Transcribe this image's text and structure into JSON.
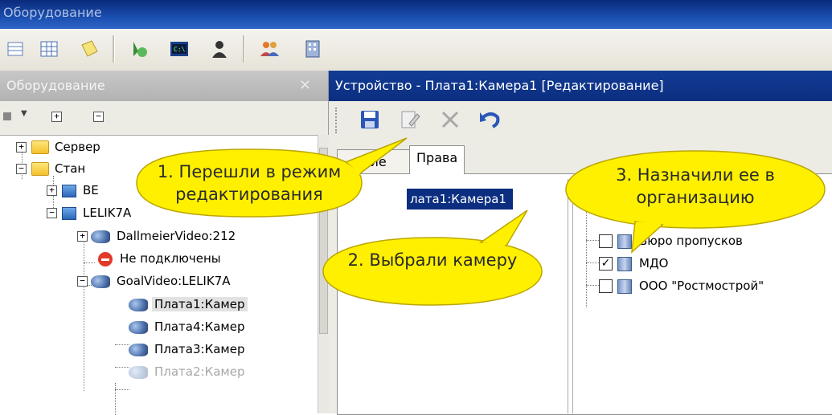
{
  "window": {
    "title": "Оборудование"
  },
  "toolbar": {
    "icons": [
      "grid-small-icon",
      "grid-icon",
      "notes-icon",
      "arrow-run-icon",
      "console-icon",
      "user-icon",
      "people-icon",
      "building-icon"
    ]
  },
  "left_panel": {
    "title": "Оборудование",
    "tree": [
      {
        "label": "Сервер"
      },
      {
        "label": "Стан"
      },
      {
        "label": "BE"
      },
      {
        "label": "LELIK7A"
      },
      {
        "label": "DallmeierVideo:212"
      },
      {
        "label": "Не подключены"
      },
      {
        "label": "GoalVideo:LELIK7A"
      },
      {
        "label": "Плата1:Камер"
      },
      {
        "label": "Плата4:Камер"
      },
      {
        "label": "Плата3:Камер"
      },
      {
        "label": "Плата2:Камер"
      }
    ]
  },
  "right_panel": {
    "title": "Устройство - Плата1:Камера1 [Редактирование]",
    "tabs": [
      "ние",
      "Права"
    ],
    "camera_item": "лата1:Камера1",
    "organizations": [
      {
        "label": "Бюро пропусков",
        "checked": false
      },
      {
        "label": "МДО",
        "checked": true
      },
      {
        "label": "ООО \"Ростмострой\"",
        "checked": false
      }
    ]
  },
  "callouts": {
    "c1": "1. Перешли в режим редактирования",
    "c2": "2. Выбрали камеру",
    "c3": "3. Назначили ее в организацию"
  },
  "colors": {
    "callout_fill": "#fff000",
    "title_active": "#0b2e80"
  }
}
